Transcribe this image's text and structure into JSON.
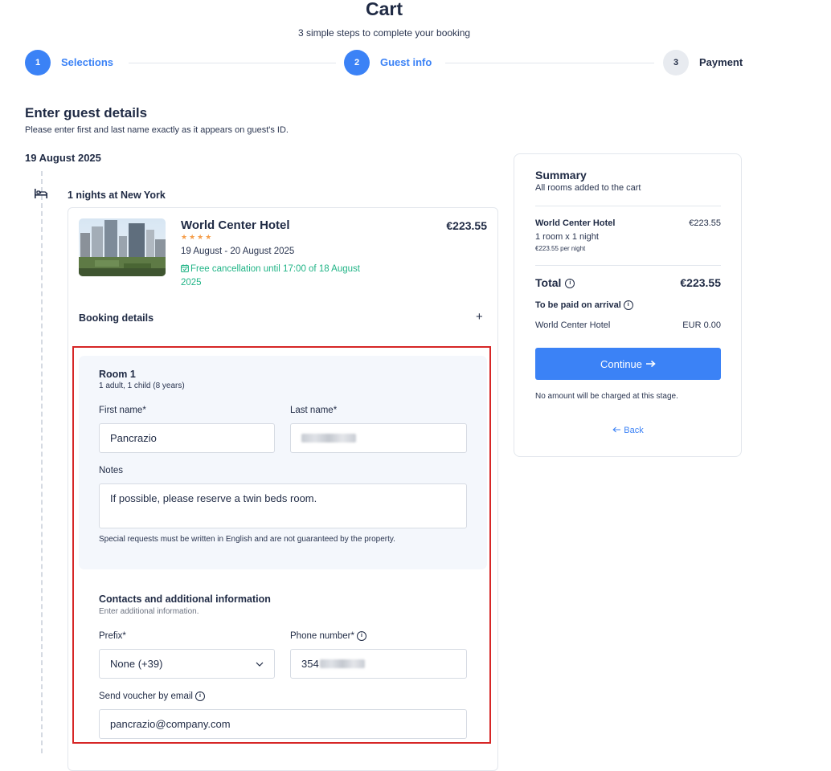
{
  "header": {
    "title": "Cart",
    "subtitle": "3 simple steps to complete your booking"
  },
  "steps": [
    {
      "number": "1",
      "label": "Selections",
      "state": "active"
    },
    {
      "number": "2",
      "label": "Guest info",
      "state": "active"
    },
    {
      "number": "3",
      "label": "Payment",
      "state": "inactive"
    }
  ],
  "guest_section": {
    "heading": "Enter guest details",
    "subheading": "Please enter first and last name exactly as it appears on guest's ID.",
    "date": "19 August 2025",
    "stay_label": "1 nights at New York"
  },
  "hotel": {
    "name": "World Center Hotel",
    "stars": "★★★★",
    "dates": "19 August - 20 August 2025",
    "free_cancellation": "Free cancellation until 17:00 of 18 August 2025",
    "price": "€223.55",
    "booking_details_label": "Booking details",
    "expand_icon": "+"
  },
  "room": {
    "title": "Room 1",
    "occupancy": "1 adult, 1 child (8 years)",
    "first_name_label": "First name*",
    "first_name_value": "Pancrazio",
    "last_name_label": "Last name*",
    "notes_label": "Notes",
    "notes_value": "If possible, please reserve a twin beds room.",
    "notes_help": "Special requests must be written in English and are not guaranteed by the property."
  },
  "contacts": {
    "title": "Contacts and additional information",
    "subtitle": "Enter additional information.",
    "prefix_label": "Prefix*",
    "prefix_value": "None (+39)",
    "phone_label": "Phone number*",
    "phone_value_visible": "354",
    "email_label": "Send voucher by email",
    "email_value": "pancrazio@company.com"
  },
  "summary": {
    "title": "Summary",
    "subtitle": "All rooms added to the cart",
    "hotel_name": "World Center Hotel",
    "hotel_price": "€223.55",
    "room_line": "1 room x 1 night",
    "per_night": "€223.55 per night",
    "total_label": "Total",
    "total_value": "€223.55",
    "arrival_label": "To be paid on arrival",
    "arrival_hotel": "World Center Hotel",
    "arrival_amount": "EUR 0.00",
    "continue_label": "Continue",
    "no_charge_note": "No amount will be charged at this stage.",
    "back_label": "Back"
  },
  "colors": {
    "accent": "#3b82f6",
    "success": "#20b486",
    "stars": "#f59e4b",
    "highlight_border": "#d62626",
    "panel_bg": "#f4f7fc"
  },
  "icons": {
    "stay": "bed-icon",
    "calendar": "calendar-check-icon",
    "info": "info-icon",
    "dropdown": "chevron-down-icon",
    "continue": "arrow-right-icon",
    "back": "arrow-left-icon"
  }
}
